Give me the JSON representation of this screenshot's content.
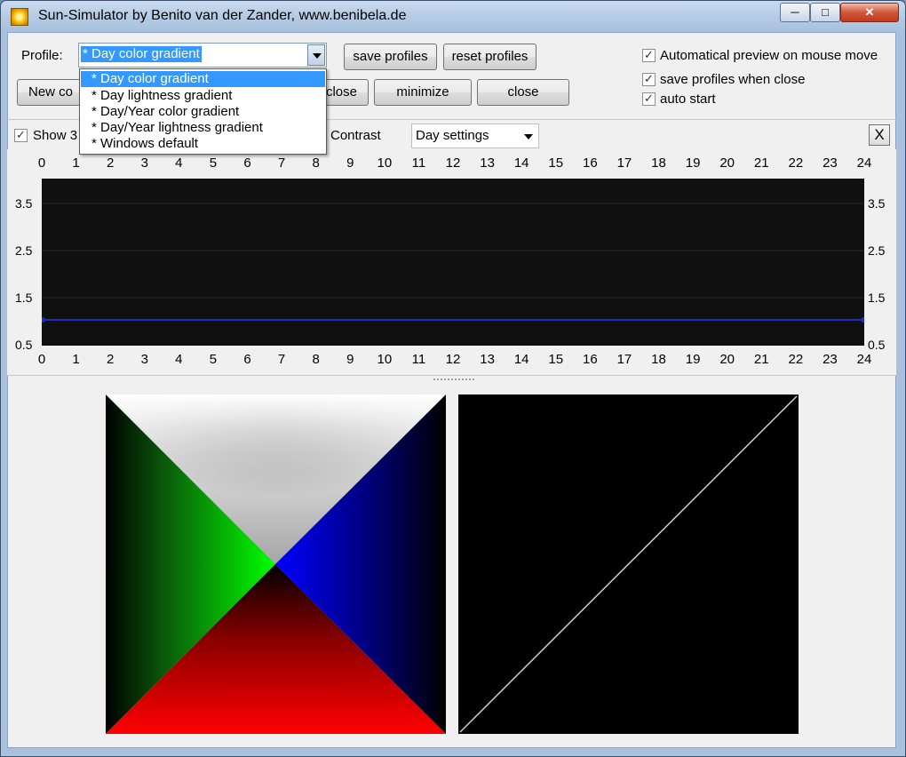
{
  "window": {
    "title": "Sun-Simulator by Benito van der Zander, www.benibela.de",
    "minimize_icon": "minimize-icon",
    "maximize_icon": "maximize-icon",
    "close_icon": "close-icon"
  },
  "profile": {
    "label": "Profile:",
    "selected": "* Day color gradient",
    "options": [
      "* Day color gradient",
      "* Day lightness gradient",
      "* Day/Year color gradient",
      "* Day/Year lightness gradient",
      "* Windows default"
    ],
    "save_label": "save profiles",
    "reset_label": "reset profiles"
  },
  "options": {
    "auto_preview": {
      "label": "Automatical preview on mouse move",
      "checked": true
    },
    "save_on_close": {
      "label": "save profiles when close",
      "checked": true
    },
    "auto_start": {
      "label": "auto start",
      "checked": true
    }
  },
  "actions": {
    "new_label": "New co",
    "close_partial_label": "close",
    "minimize_label": "minimize",
    "close_label": "close"
  },
  "toolbar": {
    "show_label": "Show 3",
    "show_checked": true,
    "contrast_label": "Contrast",
    "settings_selected": "Day settings",
    "x_label": "X"
  },
  "graph": {
    "hours": [
      "0",
      "1",
      "2",
      "3",
      "4",
      "5",
      "6",
      "7",
      "8",
      "9",
      "10",
      "11",
      "12",
      "13",
      "14",
      "15",
      "16",
      "17",
      "18",
      "19",
      "20",
      "21",
      "22",
      "23",
      "24"
    ],
    "y_ticks": [
      "3.5",
      "2.5",
      "1.5",
      "0.5"
    ],
    "background_color": "#101010",
    "line_color": "#1a2cc8",
    "line_value": 1.0
  },
  "colors": {
    "selection": "#3399ff",
    "red": "#ff0000",
    "green": "#00ff00",
    "blue": "#0000ff"
  }
}
